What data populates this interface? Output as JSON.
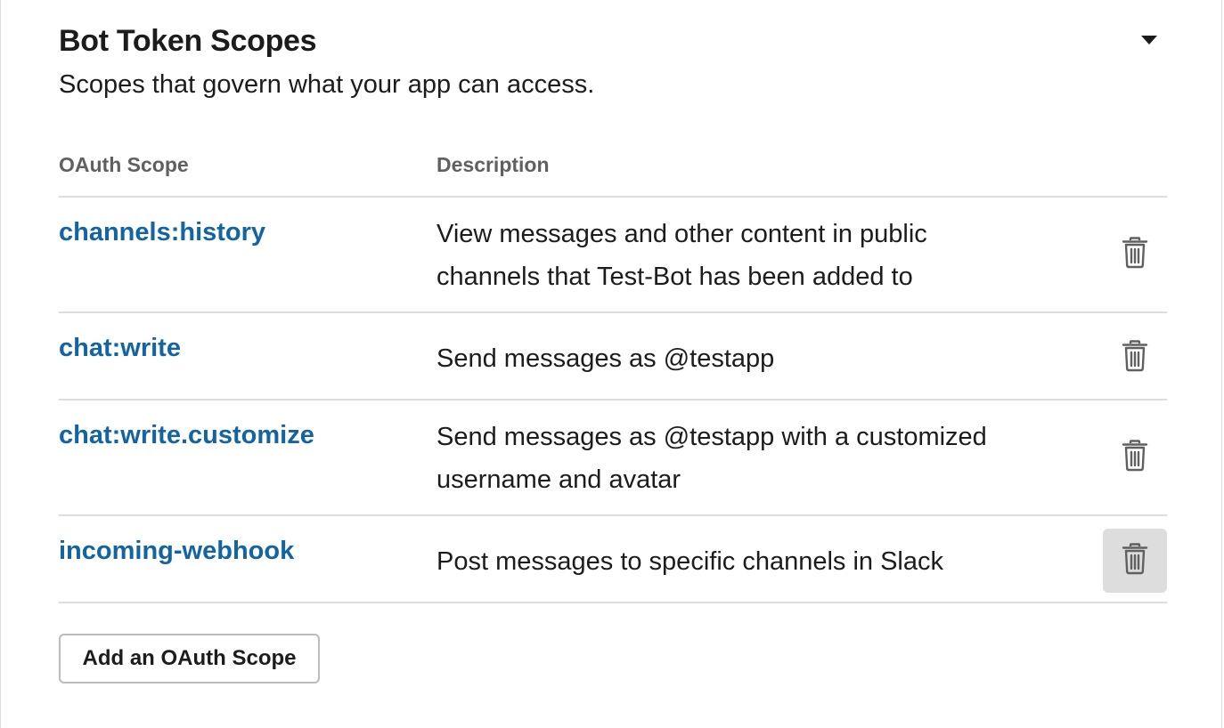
{
  "section": {
    "title": "Bot Token Scopes",
    "subtitle": "Scopes that govern what your app can access.",
    "toggle_icon": "caret-down-icon"
  },
  "table": {
    "headers": [
      "OAuth Scope",
      "Description"
    ],
    "rows": [
      {
        "scope": "channels:history",
        "description": "View messages and other content in public channels that Test-Bot has been added to",
        "action_icon": "trash-icon"
      },
      {
        "scope": "chat:write",
        "description": "Send messages as @testapp",
        "action_icon": "trash-icon"
      },
      {
        "scope": "chat:write.customize",
        "description": "Send messages as @testapp with a customized username and avatar",
        "action_icon": "trash-icon"
      },
      {
        "scope": "incoming-webhook",
        "description": "Post messages to specific channels in Slack",
        "action_icon": "trash-icon",
        "hovered": true
      }
    ]
  },
  "add_button": {
    "label": "Add an OAuth Scope"
  },
  "colors": {
    "link": "#1264a3",
    "text": "#1d1c1d",
    "header_text": "#616061",
    "divider": "#dddddd",
    "hover_bg": "#dddddd"
  }
}
